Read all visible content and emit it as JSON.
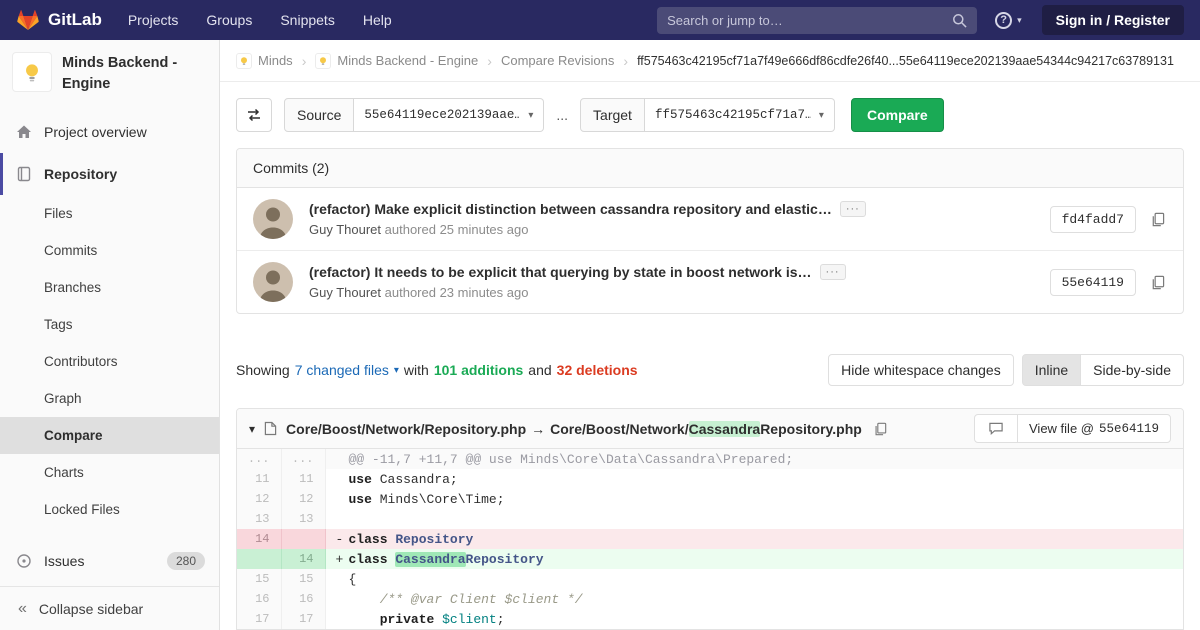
{
  "colors": {
    "navbar_bg": "#292961",
    "accent_indigo": "#4b4ba3",
    "success_green": "#1aaa55",
    "deletion_red": "#db3b21",
    "link_blue": "#1b69b6",
    "rename_highlight_green": "#c7f0d2"
  },
  "icons": {
    "chevron_down": "▾",
    "breadcrumb_separator": "›",
    "collapse_double_chevron": "«",
    "ellipsis": "···",
    "question_mark": "?"
  },
  "navbar": {
    "brand": "GitLab",
    "links": [
      "Projects",
      "Groups",
      "Snippets",
      "Help"
    ],
    "search_placeholder": "Search or jump to…",
    "signin_label": "Sign in / Register"
  },
  "sidebar": {
    "project_title": "Minds Backend - Engine",
    "overview_label": "Project overview",
    "repository_label": "Repository",
    "repo_items": [
      "Files",
      "Commits",
      "Branches",
      "Tags",
      "Contributors",
      "Graph",
      "Compare",
      "Charts",
      "Locked Files"
    ],
    "issues_label": "Issues",
    "issues_badge": "280",
    "collapse_label": "Collapse sidebar"
  },
  "breadcrumb": {
    "group": "Minds",
    "project": "Minds Backend - Engine",
    "section": "Compare Revisions",
    "current": "ff575463c42195cf71a7f49e666df86cdfe26f40...55e64119ece202139aae54344c94217c63789131"
  },
  "compare_form": {
    "source_label": "Source",
    "source_value": "55e64119ece202139aae…",
    "separator": "...",
    "target_label": "Target",
    "target_value": "ff575463c42195cf71a7…",
    "compare_button": "Compare"
  },
  "commits": {
    "header": "Commits (2)",
    "items": [
      {
        "title": "(refactor) Make explicit distinction between cassandra repository and elastic…",
        "author": "Guy Thouret",
        "meta": " authored 25 minutes ago",
        "sha": "fd4fadd7"
      },
      {
        "title": "(refactor) It needs to be explicit that querying by state in boost network is…",
        "author": "Guy Thouret",
        "meta": " authored 23 minutes ago",
        "sha": "55e64119"
      }
    ]
  },
  "changes_bar": {
    "showing": "Showing",
    "files_link": "7 changed files",
    "with_word": "with",
    "additions": "101 additions",
    "and_word": "and",
    "deletions": "32 deletions",
    "whitespace_button": "Hide whitespace changes",
    "inline_button": "Inline",
    "side_by_side_button": "Side-by-side"
  },
  "diff": {
    "file_path_old": "Core/Boost/Network/Repository.php",
    "arrow": "→",
    "file_path_new_prefix": "Core/Boost/Network/",
    "file_path_new_highlight": "Cassandra",
    "file_path_new_suffix": "Repository.php",
    "view_file_label": "View file @",
    "view_file_sha": "55e64119",
    "rows": [
      {
        "old": "...",
        "new": "...",
        "text": "@@ -11,7 +11,7 @@ use Minds\\Core\\Data\\Cassandra\\Prepared;"
      },
      {
        "old": "11",
        "new": "11",
        "kw": "use ",
        "rest": "Cassandra;"
      },
      {
        "old": "12",
        "new": "12",
        "kw": "use ",
        "rest": "Minds\\Core\\Time;"
      },
      {
        "old": "13",
        "new": "13"
      },
      {
        "old": "14",
        "new": "",
        "sign": "-",
        "kw": "class ",
        "cls": "Repository"
      },
      {
        "old": "",
        "new": "14",
        "sign": "+",
        "kw": "class ",
        "hl": "Cassandra",
        "cls": "Repository"
      },
      {
        "old": "15",
        "new": "15",
        "rest": "{"
      },
      {
        "old": "16",
        "new": "16",
        "comment": "    /** @var Client $client */"
      },
      {
        "old": "17",
        "new": "17",
        "kw": "    private ",
        "varname": "$client",
        "end": ";"
      }
    ]
  }
}
